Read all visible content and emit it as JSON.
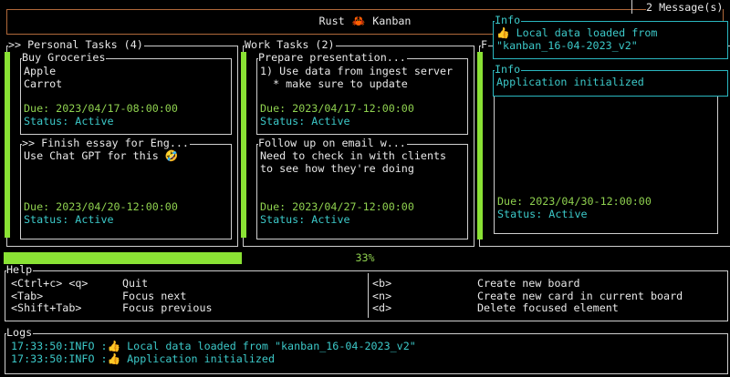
{
  "title": {
    "left": "Rust",
    "icon": "crab-icon",
    "right": "Kanban"
  },
  "messages": {
    "count_label": "2 Message(s)"
  },
  "popups": [
    {
      "title": "Info",
      "lines": [
        "👍 Local data loaded from",
        "\"kanban_16-04-2023_v2\""
      ]
    },
    {
      "title": "Info",
      "lines": [
        "Application initialized"
      ]
    }
  ],
  "boards": [
    {
      "title": ">> Personal Tasks (4)",
      "cards": [
        {
          "title": "Buy Groceries",
          "lines": [
            "Apple",
            "Carrot"
          ],
          "due": "Due: 2023/04/17-08:00:00",
          "status": "Status: Active"
        },
        {
          "title": ">> Finish essay for Eng...",
          "lines": [
            "Use Chat GPT for this 🤣"
          ],
          "due": "Due: 2023/04/20-12:00:00",
          "status": "Status: Active"
        }
      ]
    },
    {
      "title": "Work Tasks (2)",
      "cards": [
        {
          "title": "Prepare presentation...",
          "lines": [
            "1) Use data from ingest server",
            "  * make sure to update"
          ],
          "due": "Due: 2023/04/17-12:00:00",
          "status": "Status: Active"
        },
        {
          "title": "Follow up on email w...",
          "lines": [
            "Need to check in with clients",
            "to see how they're doing"
          ],
          "due": "Due: 2023/04/27-12:00:00",
          "status": "Status: Active"
        }
      ]
    },
    {
      "title": "F",
      "cards": [
        {
          "due": "Due: 2023/04/30-12:00:00",
          "status": "Status: Active"
        }
      ]
    }
  ],
  "progress": {
    "value": 33,
    "label": "33%",
    "color": "#8ae234"
  },
  "help": {
    "title": "Help",
    "left": [
      {
        "key": "<Ctrl+c> <q>",
        "action": "Quit"
      },
      {
        "key": "<Tab>",
        "action": "Focus next"
      },
      {
        "key": "<Shift+Tab>",
        "action": "Focus previous"
      }
    ],
    "right": [
      {
        "key": "<b>",
        "action": "Create new board"
      },
      {
        "key": "<n>",
        "action": "Create new card in current board"
      },
      {
        "key": "<d>",
        "action": "Delete focused element"
      }
    ]
  },
  "logs": {
    "title": "Logs",
    "entries": [
      "17:33:50:INFO :👍 Local data loaded from \"kanban_16-04-2023_v2\"",
      "17:33:50:INFO :👍 Application initialized"
    ]
  }
}
